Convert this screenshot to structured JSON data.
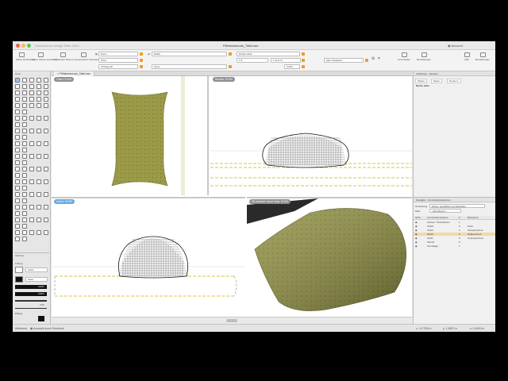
{
  "window": {
    "title": "Fitlnlectomodo_Tabll.vwx",
    "app_name": "Vectorworks Design Suite 2024"
  },
  "toolbar": {
    "left_buttons": [
      "Aktive Darstellung",
      "Aktive Klasse auswählen",
      "Infofenster Ebenen",
      "Gespeicherte Darstellungen"
    ],
    "field_klasse": "Keine",
    "field_ebene": "EG00",
    "field_ansicht": "Oben",
    "field_projektion": "Orthogonal",
    "field_render": "Drahtmodell",
    "field_lichtquellen": "Keine",
    "field_scale": "1:5",
    "field_zoom": "1:12,5 %",
    "field_offset": "0,000",
    "field_standard": "Aktiv Standard",
    "right_buttons": [
      "Umschalten",
      "Einstellungen",
      "Hilfe",
      "Einstellungen"
    ]
  },
  "left_panel": {
    "tools_title": "Tools",
    "attr_title": "Attribute",
    "attr_fill_label": "Füllung",
    "attr_fill_value": "Solid",
    "attr_pen_value": "Solid",
    "opacity_1": "100%",
    "opacity_2": "100%",
    "pen_width": "0,50",
    "effects_label": "Effekte"
  },
  "main": {
    "tab_label": "Fitlnlectomodo_Tabll.vwx",
    "viewport_top_left": "Oben: EG00",
    "viewport_top_right": "Rechts: EG00",
    "viewport_bottom_left": "Vorne: EG00",
    "viewport_bottom_right": "3D-Ansicht Vorne links: EG00"
  },
  "right_panel": {
    "header": "Infofenster - Rendern",
    "tabs": [
      "Objekt",
      "Daten",
      "Rendern"
    ],
    "empty_text": "Nichts aktiv",
    "navigator_header": "Navigator - Konstruktionsebenen",
    "darstellung_label": "Darstellung",
    "darstellung_value": "Zeigen, auswählen und bearbeiten",
    "filter_label": "Filter",
    "filter_value": "<Alle Ebenen>",
    "columns": [
      "Sicht",
      "Konstruktionsebene",
      "#",
      "Bauebene"
    ],
    "rows": [
      {
        "name": "Achsen / Schnittlinien",
        "num": "1",
        "level": ""
      },
      {
        "name": "OG03",
        "num": "2",
        "level": "Dach"
      },
      {
        "name": "OG01",
        "num": "3",
        "level": "Obergeschoss"
      },
      {
        "name": "EG00",
        "num": "4",
        "level": "Erdgeschoss"
      },
      {
        "name": "UG01",
        "num": "5",
        "level": "Untergeschoss"
      },
      {
        "name": "Schnitt",
        "num": "6",
        "level": ""
      },
      {
        "name": "Grundlage",
        "num": "7",
        "level": ""
      }
    ],
    "active_row_index": 3
  },
  "status": {
    "left": "Aktivieren",
    "hint": "Auswahl durch Rechteck",
    "coord_x": "x: -0,7226 m",
    "coord_y": "y: 1,8267 m",
    "coord_z": "z: 0,0000 m"
  },
  "colors": {
    "accent": "#3a80d8",
    "brand_orange": "#f39a1d",
    "pillow": "#9c9c4c",
    "active_row": "#f5d8a8"
  }
}
